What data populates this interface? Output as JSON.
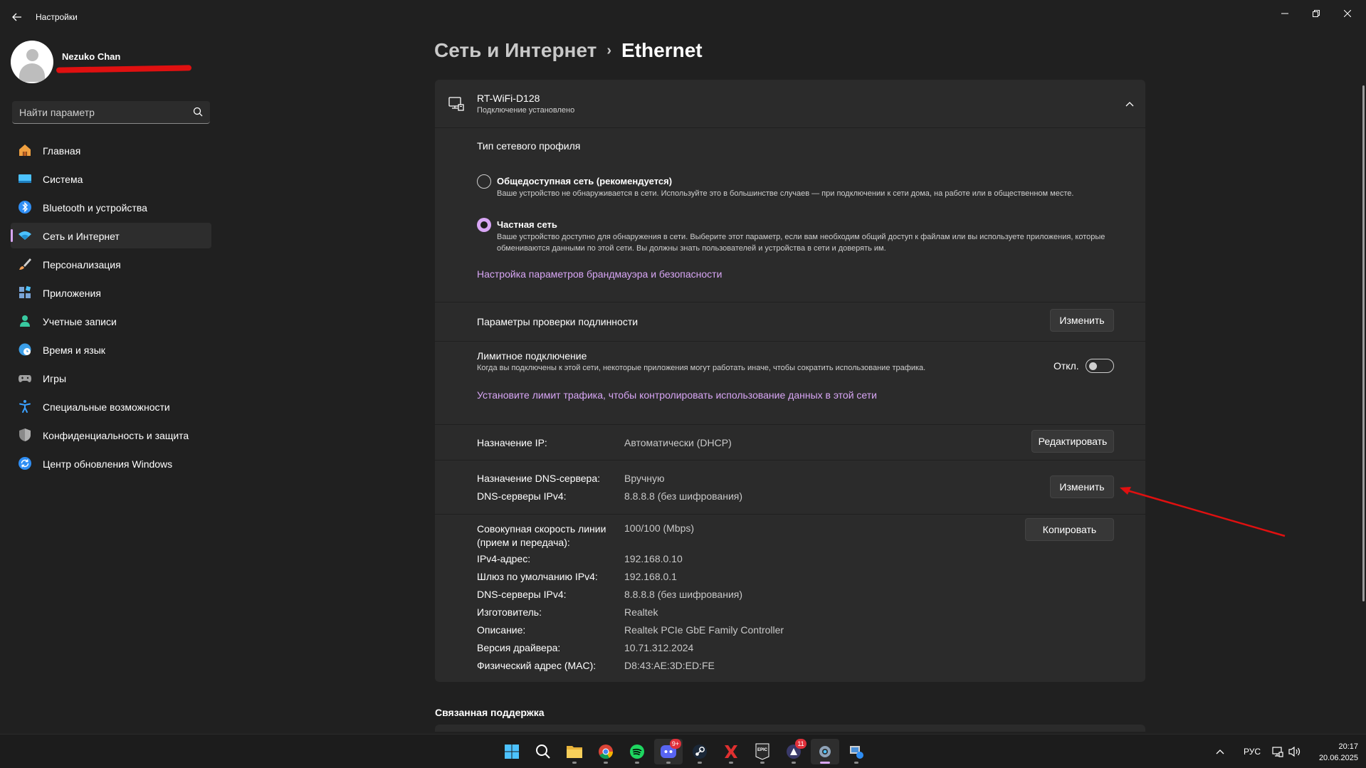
{
  "window": {
    "title": "Настройки",
    "back_icon": "arrow-left-icon"
  },
  "user": {
    "name": "Nezuko Chan"
  },
  "search": {
    "placeholder": "Найти параметр"
  },
  "sidebar": {
    "items": [
      {
        "label": "Главная",
        "icon": "home-icon",
        "color": "#f0a040"
      },
      {
        "label": "Система",
        "icon": "system-icon",
        "color": "#4cc2ff"
      },
      {
        "label": "Bluetooth и устройства",
        "icon": "bluetooth-icon",
        "color": "#2f8ef4"
      },
      {
        "label": "Сеть и Интернет",
        "icon": "wifi-icon",
        "color": "#4cc2ff"
      },
      {
        "label": "Персонализация",
        "icon": "brush-icon",
        "color": "#f2a057"
      },
      {
        "label": "Приложения",
        "icon": "apps-icon",
        "color": "#7aa5d8"
      },
      {
        "label": "Учетные записи",
        "icon": "account-icon",
        "color": "#38c9a0"
      },
      {
        "label": "Время и язык",
        "icon": "globe-clock-icon",
        "color": "#3a9ee8"
      },
      {
        "label": "Игры",
        "icon": "gamepad-icon",
        "color": "#a0a0a0"
      },
      {
        "label": "Специальные возможности",
        "icon": "accessibility-icon",
        "color": "#3aa0ff"
      },
      {
        "label": "Конфиденциальность и защита",
        "icon": "shield-icon",
        "color": "#8a8a8a"
      },
      {
        "label": "Центр обновления Windows",
        "icon": "update-icon",
        "color": "#2f8ef4"
      }
    ],
    "active_index": 3
  },
  "breadcrumb": {
    "parent": "Сеть и Интернет",
    "separator": "›",
    "current": "Ethernet"
  },
  "network": {
    "name": "RT-WiFi-D128",
    "status": "Подключение установлено"
  },
  "profile": {
    "title": "Тип сетевого профиля",
    "public_title": "Общедоступная сеть (рекомендуется)",
    "public_desc": "Ваше устройство не обнаруживается в сети. Используйте это в большинстве случаев — при подключении к сети дома, на работе или в общественном месте.",
    "private_title": "Частная сеть",
    "private_desc": "Ваше устройство доступно для обнаружения в сети. Выберите этот параметр, если вам необходим общий доступ к файлам или вы используете приложения, которые обмениваются данными по этой сети. Вы должны знать пользователей и устройства в сети и доверять им.",
    "selected": "private",
    "firewall_link": "Настройка параметров брандмауэра и безопасности"
  },
  "auth": {
    "label": "Параметры проверки подлинности",
    "button": "Изменить"
  },
  "metered": {
    "label": "Лимитное подключение",
    "desc": "Когда вы подключены к этой сети, некоторые приложения могут работать иначе, чтобы сократить использование трафика.",
    "state_label": "Откл.",
    "enabled": false,
    "link": "Установите лимит трафика, чтобы контролировать использование данных в этой сети"
  },
  "ip": {
    "label": "Назначение IP:",
    "value": "Автоматически (DHCP)",
    "button": "Редактировать"
  },
  "dns": {
    "label": "Назначение DNS-сервера:",
    "value": "Вручную",
    "ipv4_label": "DNS-серверы IPv4:",
    "ipv4_value": "8.8.8.8 (без шифрования)",
    "button": "Изменить"
  },
  "properties": {
    "button": "Копировать",
    "rows": [
      {
        "label": "Совокупная скорость линии (прием и передача):",
        "value": "100/100 (Mbps)"
      },
      {
        "label": "IPv4-адрес:",
        "value": "192.168.0.10"
      },
      {
        "label": "Шлюз по умолчанию IPv4:",
        "value": "192.168.0.1"
      },
      {
        "label": "DNS-серверы IPv4:",
        "value": "8.8.8.8 (без шифрования)"
      },
      {
        "label": "Изготовитель:",
        "value": "Realtek"
      },
      {
        "label": "Описание:",
        "value": "Realtek PCIe GbE Family Controller"
      },
      {
        "label": "Версия драйвера:",
        "value": "10.71.312.2024"
      },
      {
        "label": "Физический адрес (MAC):",
        "value": "D8:43:AE:3D:ED:FE"
      }
    ]
  },
  "related": {
    "title": "Связанная поддержка"
  },
  "taskbar": {
    "apps": [
      {
        "name": "start-icon"
      },
      {
        "name": "search-icon"
      },
      {
        "name": "file-explorer-icon"
      },
      {
        "name": "chrome-icon"
      },
      {
        "name": "spotify-icon"
      },
      {
        "name": "discord-icon",
        "badge": "9+"
      },
      {
        "name": "steam-icon"
      },
      {
        "name": "x-app-icon"
      },
      {
        "name": "epic-games-icon",
        "text": "EPIC"
      },
      {
        "name": "game-app-icon",
        "badge": "11"
      },
      {
        "name": "settings-icon",
        "active": true
      },
      {
        "name": "network-tool-icon"
      }
    ],
    "language": "РУС",
    "time": "20:17",
    "date": "20.06.2025"
  },
  "annotation_color": "#e01010",
  "accent_color": "#d8a6f5"
}
